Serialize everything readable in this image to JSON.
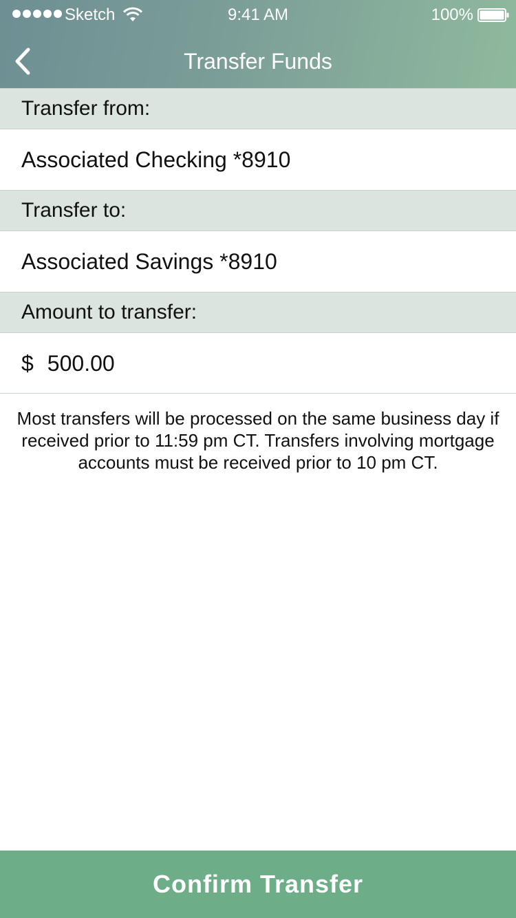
{
  "status_bar": {
    "carrier": "Sketch",
    "time": "9:41 AM",
    "battery": "100%"
  },
  "nav": {
    "title": "Transfer Funds",
    "back_icon": "chevron-left-icon"
  },
  "form": {
    "from_label": "Transfer from:",
    "from_value": "Associated Checking *8910",
    "to_label": "Transfer to:",
    "to_value": "Associated Savings *8910",
    "amount_label": "Amount to transfer:",
    "currency_symbol": "$",
    "amount_value": "500.00"
  },
  "disclaimer": "Most transfers will be processed on the same business day if received prior to 11:59 pm CT. Transfers involving mortgage accounts must be received prior to 10 pm CT.",
  "confirm_label": "Confirm Transfer",
  "colors": {
    "header_gradient_start": "#6e8f93",
    "header_gradient_end": "#8fb99d",
    "section_bg": "#dce4df",
    "confirm_button": "#6dae88"
  }
}
